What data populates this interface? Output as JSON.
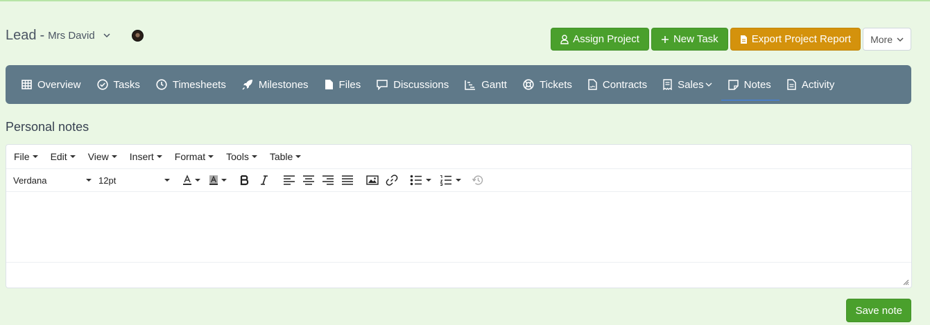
{
  "header": {
    "title": "Lead",
    "separator": "-",
    "client_name": "Mrs David"
  },
  "actions": {
    "assign_project": "Assign Project",
    "new_task": "New Task",
    "export_report": "Export Project Report",
    "more": "More"
  },
  "tabs": [
    {
      "label": "Overview",
      "icon": "table-icon"
    },
    {
      "label": "Tasks",
      "icon": "check-circle-icon"
    },
    {
      "label": "Timesheets",
      "icon": "clock-icon"
    },
    {
      "label": "Milestones",
      "icon": "rocket-icon"
    },
    {
      "label": "Files",
      "icon": "file-icon"
    },
    {
      "label": "Discussions",
      "icon": "chat-icon"
    },
    {
      "label": "Gantt",
      "icon": "gantt-icon"
    },
    {
      "label": "Tickets",
      "icon": "lifering-icon"
    },
    {
      "label": "Contracts",
      "icon": "contract-icon"
    },
    {
      "label": "Sales",
      "icon": "receipt-icon"
    },
    {
      "label": "Notes",
      "icon": "note-icon",
      "active": true
    },
    {
      "label": "Activity",
      "icon": "document-icon"
    }
  ],
  "section": {
    "title": "Personal notes"
  },
  "editor": {
    "menus": [
      "File",
      "Edit",
      "View",
      "Insert",
      "Format",
      "Tools",
      "Table"
    ],
    "font_family": "Verdana",
    "font_size": "12pt",
    "content": ""
  },
  "save_button": "Save note",
  "colors": {
    "background": "#eaf7e4",
    "tabbar": "#5f7989",
    "green": "#4aa02c",
    "orange": "#d4920c"
  }
}
